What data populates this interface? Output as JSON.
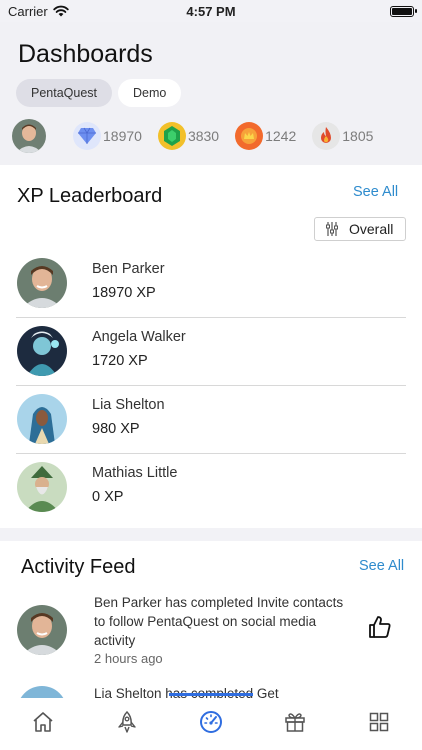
{
  "status_bar": {
    "carrier": "Carrier",
    "time": "4:57 PM"
  },
  "header": {
    "title": "Dashboards",
    "tabs": [
      {
        "label": "PentaQuest",
        "active": true
      },
      {
        "label": "Demo",
        "active": false
      }
    ],
    "stats": [
      {
        "icon": "diamond-icon",
        "value": "18970",
        "color": "#6d8ff0"
      },
      {
        "icon": "emerald-gem-icon",
        "value": "3830",
        "color": "#1fa24a"
      },
      {
        "icon": "crown-coin-icon",
        "value": "1242",
        "color": "#f26a2c"
      },
      {
        "icon": "flame-icon",
        "value": "1805",
        "color": "#e04b2c"
      }
    ]
  },
  "leaderboard": {
    "title": "XP Leaderboard",
    "see_all": "See All",
    "filter_label": "Overall",
    "rows": [
      {
        "name": "Ben Parker",
        "xp": "18970 XP"
      },
      {
        "name": "Angela Walker",
        "xp": "1720 XP"
      },
      {
        "name": "Lia Shelton",
        "xp": "980 XP"
      },
      {
        "name": "Mathias Little",
        "xp": "0 XP"
      }
    ]
  },
  "activity_feed": {
    "title": "Activity Feed",
    "see_all": "See All",
    "items": [
      {
        "text": "Ben Parker has completed Invite contacts to follow PentaQuest on social media activity",
        "time": "2 hours ago"
      }
    ],
    "partial_next_text": "Lia Shelton has completed Get"
  },
  "tabbar": {
    "items": [
      "home-icon",
      "rocket-icon",
      "dashboard-gauge-icon",
      "gift-icon",
      "grid-icon"
    ],
    "active_index": 2
  },
  "colors": {
    "accent": "#2e8bcd",
    "active_tab_indicator": "#2f6de0"
  }
}
